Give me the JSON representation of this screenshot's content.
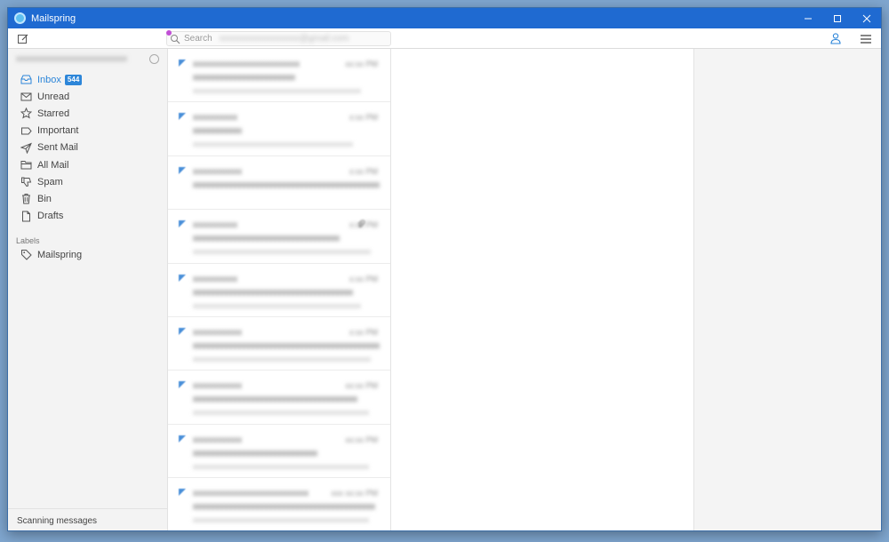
{
  "window": {
    "title": "Mailspring"
  },
  "search": {
    "placeholder": "Search",
    "account": "xxxxxxxxxxxxxxxxxx@gmail.com"
  },
  "account": {
    "name": "xxxxxxxxxxxxxxxxxxxxxxxxxxxxxx"
  },
  "sidebar": {
    "items": [
      {
        "label": "Inbox",
        "icon": "inbox-icon",
        "badge": "544",
        "active": true
      },
      {
        "label": "Unread",
        "icon": "mail-icon"
      },
      {
        "label": "Starred",
        "icon": "star-icon"
      },
      {
        "label": "Important",
        "icon": "label-icon"
      },
      {
        "label": "Sent Mail",
        "icon": "send-icon"
      },
      {
        "label": "All Mail",
        "icon": "folder-icon"
      },
      {
        "label": "Spam",
        "icon": "thumbs-down-icon"
      },
      {
        "label": "Bin",
        "icon": "trash-icon"
      },
      {
        "label": "Drafts",
        "icon": "document-icon"
      }
    ],
    "labels_heading": "Labels",
    "labels": [
      {
        "label": "Mailspring",
        "icon": "tag-icon"
      }
    ],
    "status": "Scanning messages"
  },
  "messages": [
    {
      "sender": "xxxxxxxxxxxxxxxxxxxxxxxx",
      "time": "xx:xx PM",
      "subject": "xxxxxxxxxxxxxxxxxxxxxxx",
      "snippet": "xxxxxxxxxxxxxxxxxxxxxxxxxxxxxxxxxxxxxxxxxx"
    },
    {
      "sender": "xxxxxxxxxx",
      "time": "x:xx PM",
      "subject": "xxxxxxxxxxx",
      "snippet": "xxxxxxxxxxxxxxxxxxxxxxxxxxxxxxxxxxxxxxxx"
    },
    {
      "sender": "xxxxxxxxxxx",
      "time": "x:xx PM",
      "subject": "xxxxxxxxxxxxxxxxxxxxxxxxxxxxxxxxxxxxxxxxxxxx",
      "snippet": ""
    },
    {
      "sender": "xxxxxxxxxx",
      "time": "x:xx PM",
      "subject": "xxxxxxxxxxxxxxxxxxxxxxxxxxxxxxxxx",
      "snippet": "xxxxxxxxxxxxxxxxxxxxxxxxxxxxxxxxxxxxxxxxxxxxxx",
      "attachment": true
    },
    {
      "sender": "xxxxxxxxxx",
      "time": "x:xx PM",
      "subject": "xxxxxxxxxxxxxxxxxxxxxxxxxxxxxxxxxxxx",
      "snippet": "xxxxxxxxxxxxxxxxxxxxxxxxxxxxxxxxxxxxxxxxxx"
    },
    {
      "sender": "xxxxxxxxxxx",
      "time": "x:xx PM",
      "subject": "xxxxxxxxxxxxxxxxxxxxxxxxxxxxxxxxxxxxxxxxxx",
      "snippet": "xxxxxxxxxxxxxxxxxxxxxxxxxxxxxxxxxxxxxxxxxxxxx"
    },
    {
      "sender": "xxxxxxxxxxx",
      "time": "xx:xx PM",
      "subject": "xxxxxxxxxxxxxxxxxxxxxxxxxxxxxxxxxxxxx",
      "snippet": "xxxxxxxxxxxxxxxxxxxxxxxxxxxxxxxxxxxxxxxxxxxx"
    },
    {
      "sender": "xxxxxxxxxxx",
      "time": "xx:xx PM",
      "subject": "xxxxxxxxxxxxxxxxxxxxxxxxxxxx",
      "snippet": "xxxxxxxxxxxxxxxxxxxxxxxxxxxxxxxxxxxxxxxxxxxx"
    },
    {
      "sender": "xxxxxxxxxxxxxxxxxxxxxxxxxx",
      "time": "xxx xx:xx PM",
      "subject": "xxxxxxxxxxxxxxxxxxxxxxxxxxxxxxxxxxxxxxxxx",
      "snippet": "xxxxxxxxxxxxxxxxxxxxxxxxxxxxxxxxxxxxxxxxxxxx"
    }
  ],
  "colors": {
    "titlebar": "#1f6ad1",
    "accent": "#2d86d9",
    "sidebar_bg": "#f3f3f3"
  }
}
